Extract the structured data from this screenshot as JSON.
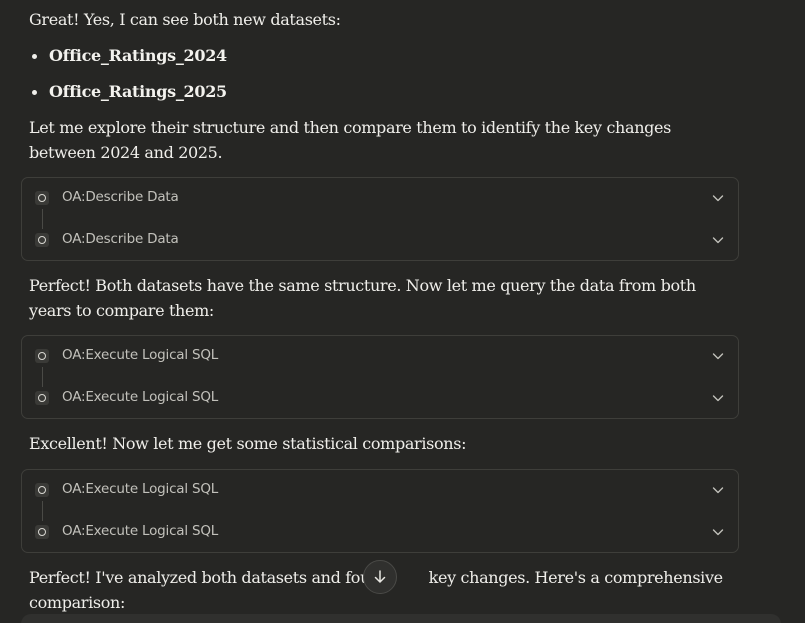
{
  "messages": {
    "intro": "Great! Yes, I can see both new datasets:",
    "datasets": [
      "Office_Ratings_2024",
      "Office_Ratings_2025"
    ],
    "explore": "Let me explore their structure and then compare them to identify the key changes between 2024 and 2025.",
    "perfect_structure": "Perfect! Both datasets have the same structure. Now let me query the data from both years to compare them:",
    "excellent": "Excellent! Now let me get some statistical comparisons:",
    "final_before": "Perfect! I've analyzed both datasets and found",
    "final_after": " key changes. Here's a comprehensive comparison:"
  },
  "tool_groups": [
    {
      "items": [
        "OA:Describe Data",
        "OA:Describe Data"
      ]
    },
    {
      "items": [
        "OA:Execute Logical SQL",
        "OA:Execute Logical SQL"
      ]
    },
    {
      "items": [
        "OA:Execute Logical SQL",
        "OA:Execute Logical SQL"
      ]
    }
  ],
  "icons": {
    "tool": "tool-circle-icon",
    "expand": "chevron-down-icon",
    "scroll": "arrow-down-icon"
  },
  "colors": {
    "background": "#262624",
    "card_border": "#3e3e3a",
    "text": "#efeeea",
    "muted_text": "#c2c1bb"
  }
}
